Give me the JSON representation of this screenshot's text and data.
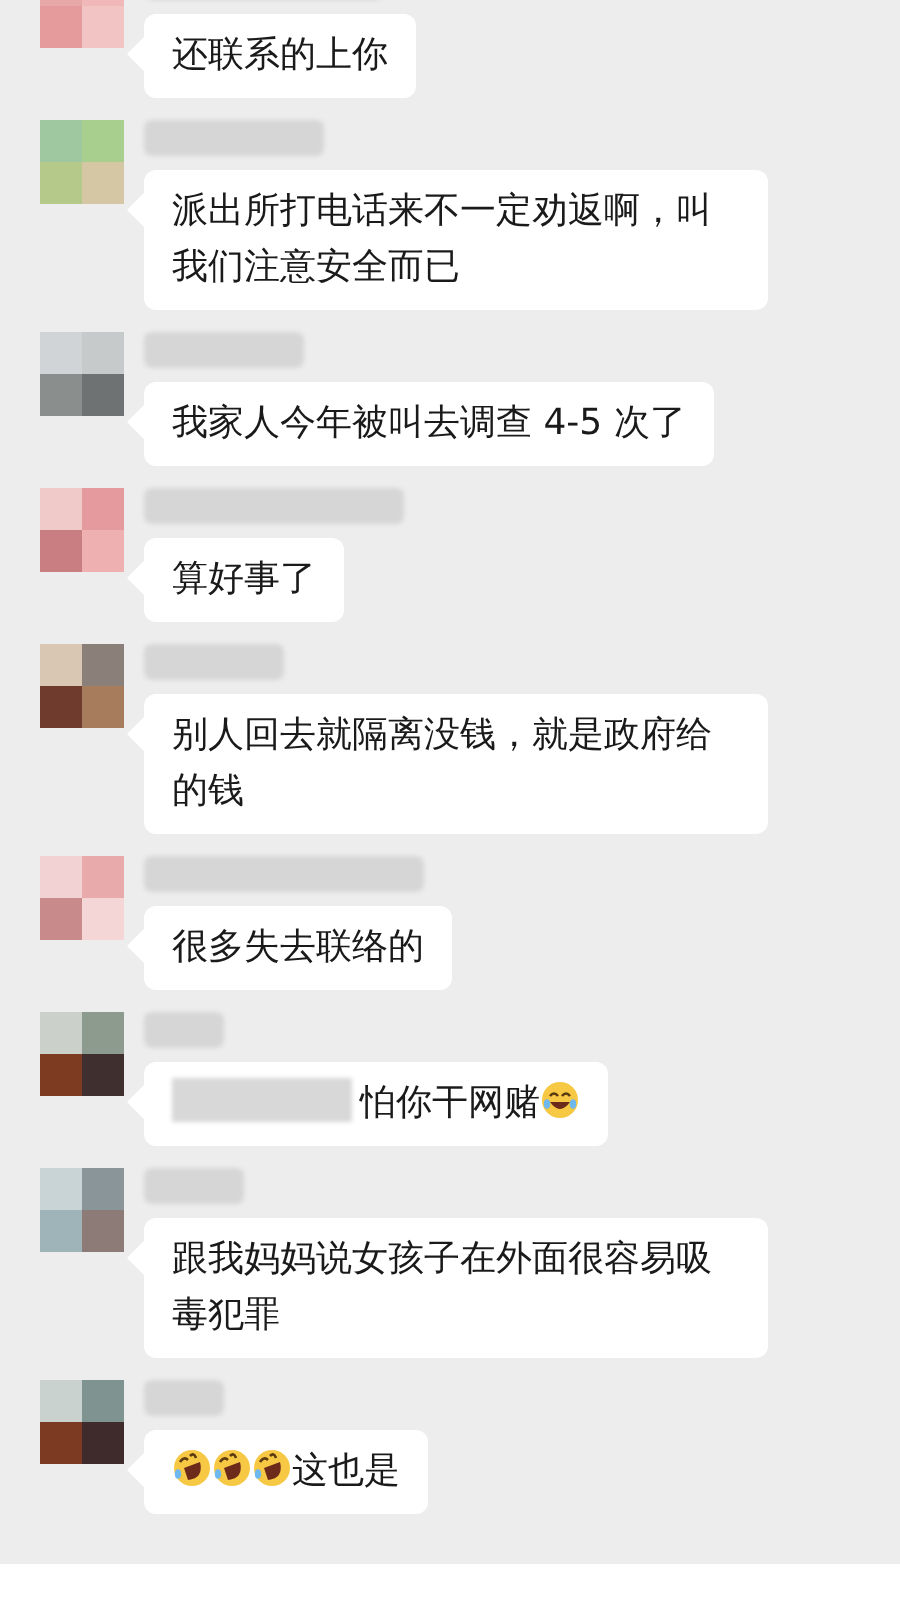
{
  "messages": [
    {
      "text": "还联系的上你"
    },
    {
      "text": "派出所打电话来不一定劝返啊，叫我们注意安全而已"
    },
    {
      "text": "我家人今年被叫去调查 4-5 次了"
    },
    {
      "text": "算好事了"
    },
    {
      "text": "别人回去就隔离没钱，就是政府给的钱"
    },
    {
      "text": "很多失去联络的"
    },
    {
      "text": "怕你干网赌",
      "redacted_prefix": true,
      "trailing_emoji": [
        {
          "kind": "laughing"
        }
      ]
    },
    {
      "text": "跟我妈妈说女孩子在外面很容易吸毒犯罪"
    },
    {
      "text": "这也是",
      "leading_emoji": [
        {
          "kind": "rolling"
        },
        {
          "kind": "rolling"
        },
        {
          "kind": "rolling"
        }
      ]
    }
  ]
}
